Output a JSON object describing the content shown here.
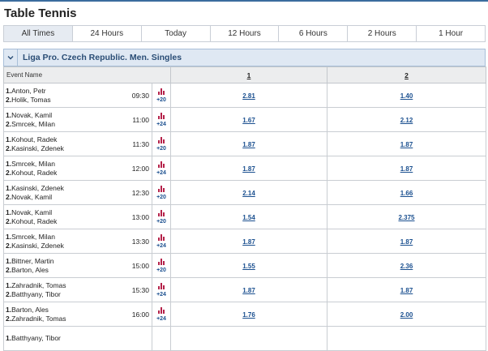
{
  "page": {
    "title": "Table Tennis"
  },
  "tabs": [
    "All Times",
    "24 Hours",
    "Today",
    "12 Hours",
    "6 Hours",
    "2 Hours",
    "1 Hour"
  ],
  "active_tab": 0,
  "league": {
    "name": "Liga Pro. Czech Republic. Men. Singles",
    "chevron": "chevron-down-icon"
  },
  "table": {
    "headers": {
      "event": "Event Name",
      "odd1": "1",
      "odd2": "2"
    },
    "rows": [
      {
        "p1": "Anton, Petr",
        "p2": "Holik, Tomas",
        "time": "09:30",
        "more": "+20",
        "o1": "2.81",
        "o2": "1.40"
      },
      {
        "p1": "Novak, Kamil",
        "p2": "Smrcek, Milan",
        "time": "11:00",
        "more": "+24",
        "o1": "1.67",
        "o2": "2.12"
      },
      {
        "p1": "Kohout, Radek",
        "p2": "Kasinski, Zdenek",
        "time": "11:30",
        "more": "+20",
        "o1": "1.87",
        "o2": "1.87"
      },
      {
        "p1": "Smrcek, Milan",
        "p2": "Kohout, Radek",
        "time": "12:00",
        "more": "+24",
        "o1": "1.87",
        "o2": "1.87"
      },
      {
        "p1": "Kasinski, Zdenek",
        "p2": "Novak, Kamil",
        "time": "12:30",
        "more": "+20",
        "o1": "2.14",
        "o2": "1.66"
      },
      {
        "p1": "Novak, Kamil",
        "p2": "Kohout, Radek",
        "time": "13:00",
        "more": "+20",
        "o1": "1.54",
        "o2": "2.375"
      },
      {
        "p1": "Smrcek, Milan",
        "p2": "Kasinski, Zdenek",
        "time": "13:30",
        "more": "+24",
        "o1": "1.87",
        "o2": "1.87"
      },
      {
        "p1": "Bittner, Martin",
        "p2": "Barton, Ales",
        "time": "15:00",
        "more": "+20",
        "o1": "1.55",
        "o2": "2.36"
      },
      {
        "p1": "Zahradnik, Tomas",
        "p2": "Batthyany, Tibor",
        "time": "15:30",
        "more": "+24",
        "o1": "1.87",
        "o2": "1.87"
      },
      {
        "p1": "Barton, Ales",
        "p2": "Zahradnik, Tomas",
        "time": "16:00",
        "more": "+24",
        "o1": "1.76",
        "o2": "2.00"
      },
      {
        "p1": "Batthyany, Tibor",
        "p2": "",
        "time": "",
        "more": "",
        "o1": "",
        "o2": ""
      }
    ]
  },
  "colors": {
    "accent": "#1a4f8f",
    "stats_icon": "#b5224a",
    "league_bg": "#dfe8f3"
  },
  "icons": {
    "stats": "bar-chart-icon"
  }
}
